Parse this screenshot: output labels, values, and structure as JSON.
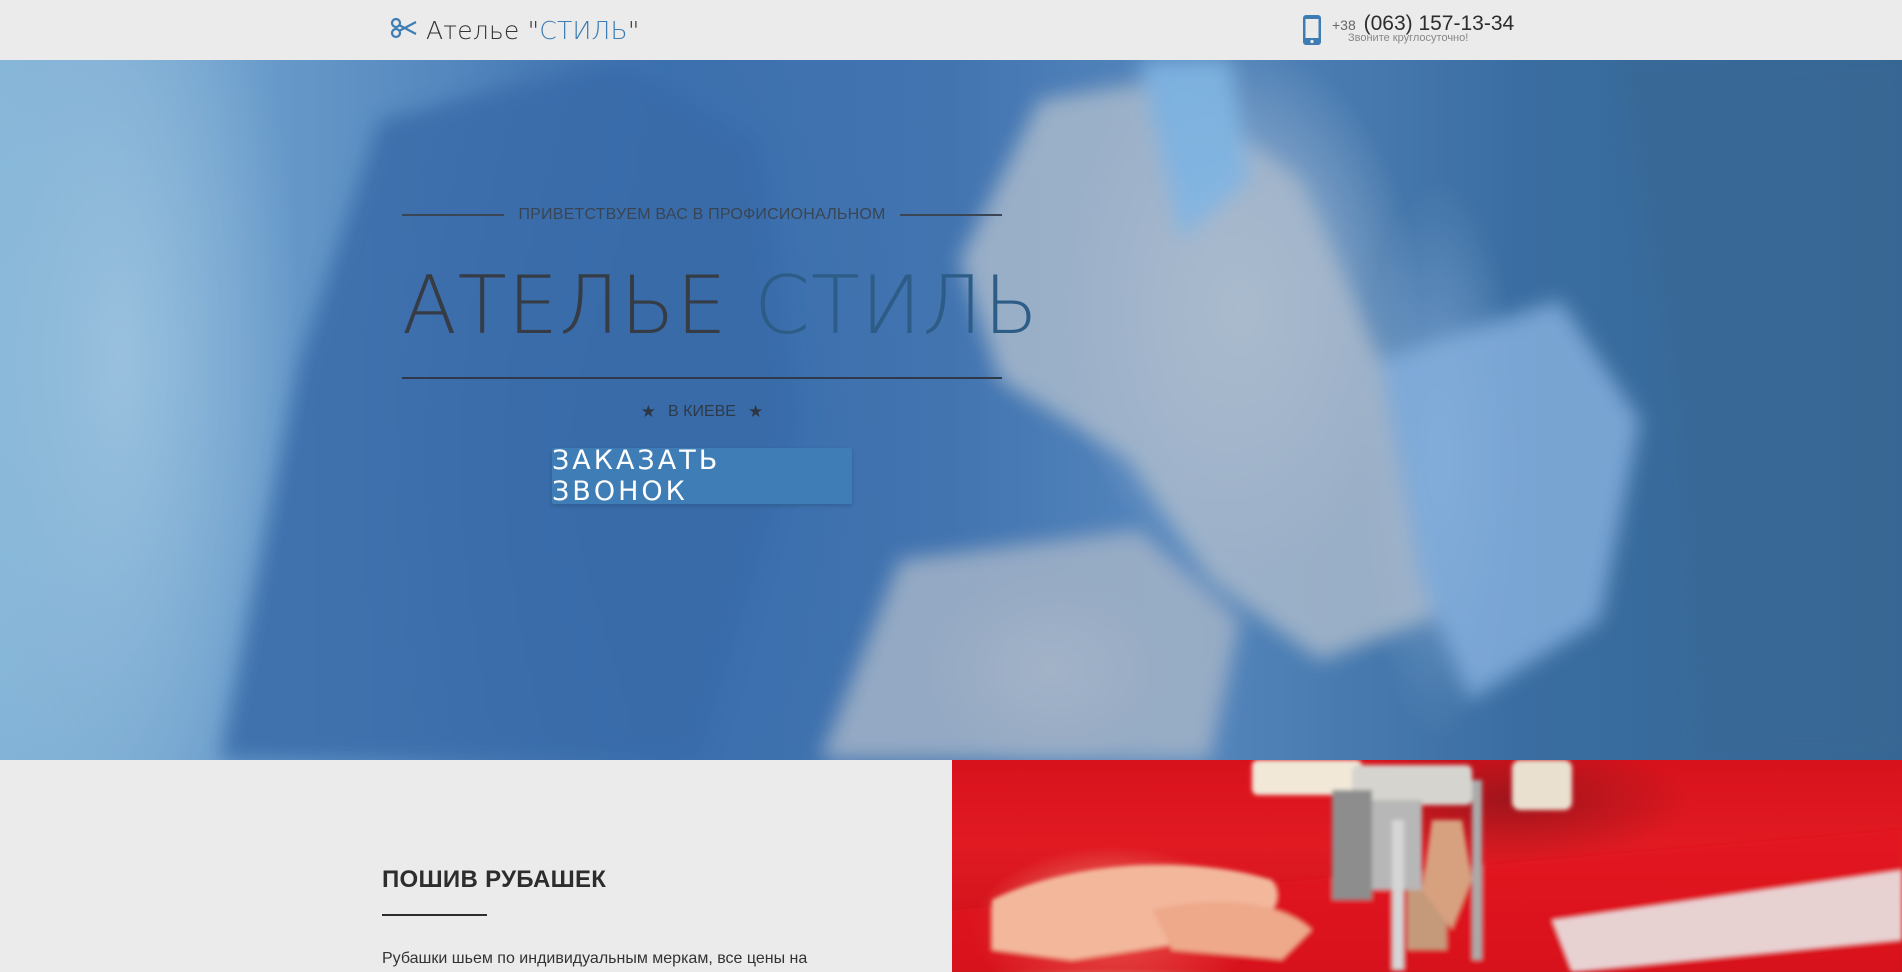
{
  "header": {
    "brand_name": "Ателье ",
    "brand_quote_open": "\"",
    "brand_accent": "СТИЛЬ",
    "brand_quote_close": "\"",
    "phone_prefix": "+38",
    "phone_number": "(063) 157-13-34",
    "phone_note": "Звоните круглосуточно!"
  },
  "hero": {
    "kicker": "ПРИВЕТСТВУЕМ ВАС В ПРОФИСИОНАЛЬНОМ",
    "title_word1": "АТЕЛЬЕ",
    "title_word2": "СТИЛЬ",
    "city": "В КИЕВЕ",
    "cta_label": "ЗАКАЗАТЬ ЗВОНОК"
  },
  "section": {
    "title": "ПОШИВ РУБАШЕК",
    "text": "Рубашки шьем по индивидуальным меркам, все цены на"
  },
  "colors": {
    "accent": "#3e7db5",
    "header_bg": "#ebebeb",
    "text_dark": "#333333"
  },
  "icons": {
    "brand": "scissors-icon",
    "phone": "smartphone-icon",
    "star": "star-icon"
  }
}
